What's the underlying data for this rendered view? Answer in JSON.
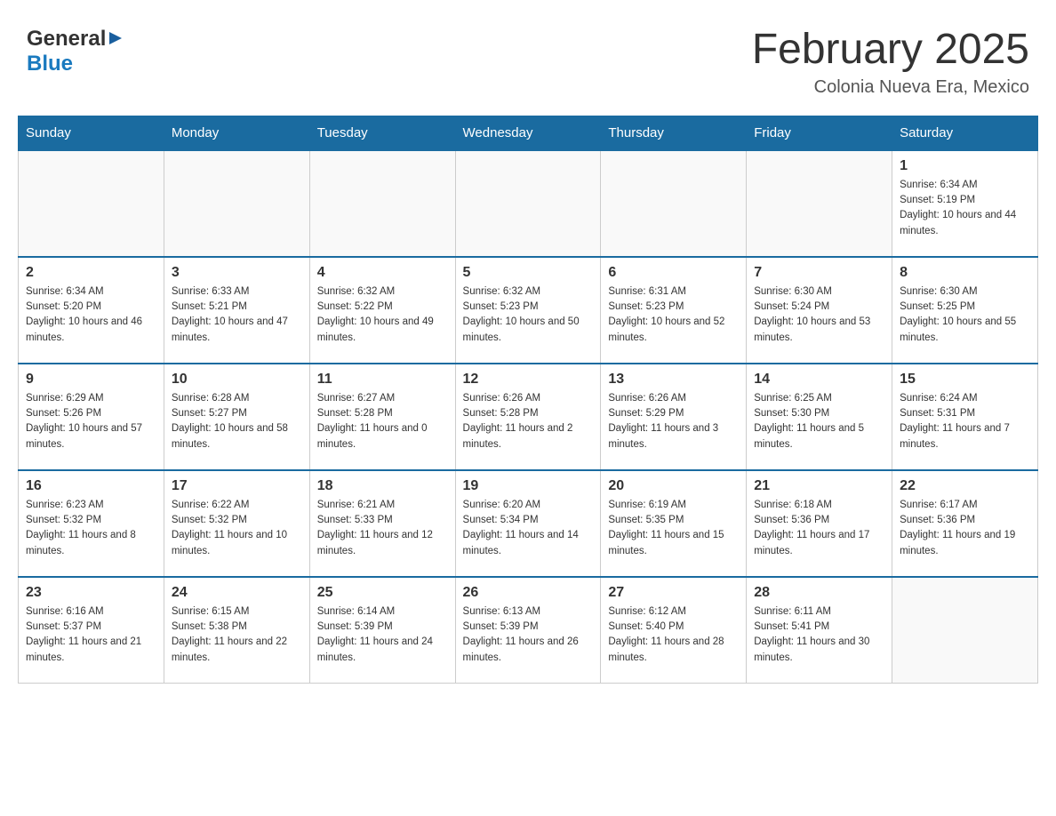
{
  "header": {
    "logo_general": "General",
    "logo_blue": "Blue",
    "month_title": "February 2025",
    "location": "Colonia Nueva Era, Mexico"
  },
  "days_of_week": [
    "Sunday",
    "Monday",
    "Tuesday",
    "Wednesday",
    "Thursday",
    "Friday",
    "Saturday"
  ],
  "weeks": [
    {
      "days": [
        {
          "num": "",
          "info": ""
        },
        {
          "num": "",
          "info": ""
        },
        {
          "num": "",
          "info": ""
        },
        {
          "num": "",
          "info": ""
        },
        {
          "num": "",
          "info": ""
        },
        {
          "num": "",
          "info": ""
        },
        {
          "num": "1",
          "info": "Sunrise: 6:34 AM\nSunset: 5:19 PM\nDaylight: 10 hours and 44 minutes."
        }
      ]
    },
    {
      "days": [
        {
          "num": "2",
          "info": "Sunrise: 6:34 AM\nSunset: 5:20 PM\nDaylight: 10 hours and 46 minutes."
        },
        {
          "num": "3",
          "info": "Sunrise: 6:33 AM\nSunset: 5:21 PM\nDaylight: 10 hours and 47 minutes."
        },
        {
          "num": "4",
          "info": "Sunrise: 6:32 AM\nSunset: 5:22 PM\nDaylight: 10 hours and 49 minutes."
        },
        {
          "num": "5",
          "info": "Sunrise: 6:32 AM\nSunset: 5:23 PM\nDaylight: 10 hours and 50 minutes."
        },
        {
          "num": "6",
          "info": "Sunrise: 6:31 AM\nSunset: 5:23 PM\nDaylight: 10 hours and 52 minutes."
        },
        {
          "num": "7",
          "info": "Sunrise: 6:30 AM\nSunset: 5:24 PM\nDaylight: 10 hours and 53 minutes."
        },
        {
          "num": "8",
          "info": "Sunrise: 6:30 AM\nSunset: 5:25 PM\nDaylight: 10 hours and 55 minutes."
        }
      ]
    },
    {
      "days": [
        {
          "num": "9",
          "info": "Sunrise: 6:29 AM\nSunset: 5:26 PM\nDaylight: 10 hours and 57 minutes."
        },
        {
          "num": "10",
          "info": "Sunrise: 6:28 AM\nSunset: 5:27 PM\nDaylight: 10 hours and 58 minutes."
        },
        {
          "num": "11",
          "info": "Sunrise: 6:27 AM\nSunset: 5:28 PM\nDaylight: 11 hours and 0 minutes."
        },
        {
          "num": "12",
          "info": "Sunrise: 6:26 AM\nSunset: 5:28 PM\nDaylight: 11 hours and 2 minutes."
        },
        {
          "num": "13",
          "info": "Sunrise: 6:26 AM\nSunset: 5:29 PM\nDaylight: 11 hours and 3 minutes."
        },
        {
          "num": "14",
          "info": "Sunrise: 6:25 AM\nSunset: 5:30 PM\nDaylight: 11 hours and 5 minutes."
        },
        {
          "num": "15",
          "info": "Sunrise: 6:24 AM\nSunset: 5:31 PM\nDaylight: 11 hours and 7 minutes."
        }
      ]
    },
    {
      "days": [
        {
          "num": "16",
          "info": "Sunrise: 6:23 AM\nSunset: 5:32 PM\nDaylight: 11 hours and 8 minutes."
        },
        {
          "num": "17",
          "info": "Sunrise: 6:22 AM\nSunset: 5:32 PM\nDaylight: 11 hours and 10 minutes."
        },
        {
          "num": "18",
          "info": "Sunrise: 6:21 AM\nSunset: 5:33 PM\nDaylight: 11 hours and 12 minutes."
        },
        {
          "num": "19",
          "info": "Sunrise: 6:20 AM\nSunset: 5:34 PM\nDaylight: 11 hours and 14 minutes."
        },
        {
          "num": "20",
          "info": "Sunrise: 6:19 AM\nSunset: 5:35 PM\nDaylight: 11 hours and 15 minutes."
        },
        {
          "num": "21",
          "info": "Sunrise: 6:18 AM\nSunset: 5:36 PM\nDaylight: 11 hours and 17 minutes."
        },
        {
          "num": "22",
          "info": "Sunrise: 6:17 AM\nSunset: 5:36 PM\nDaylight: 11 hours and 19 minutes."
        }
      ]
    },
    {
      "days": [
        {
          "num": "23",
          "info": "Sunrise: 6:16 AM\nSunset: 5:37 PM\nDaylight: 11 hours and 21 minutes."
        },
        {
          "num": "24",
          "info": "Sunrise: 6:15 AM\nSunset: 5:38 PM\nDaylight: 11 hours and 22 minutes."
        },
        {
          "num": "25",
          "info": "Sunrise: 6:14 AM\nSunset: 5:39 PM\nDaylight: 11 hours and 24 minutes."
        },
        {
          "num": "26",
          "info": "Sunrise: 6:13 AM\nSunset: 5:39 PM\nDaylight: 11 hours and 26 minutes."
        },
        {
          "num": "27",
          "info": "Sunrise: 6:12 AM\nSunset: 5:40 PM\nDaylight: 11 hours and 28 minutes."
        },
        {
          "num": "28",
          "info": "Sunrise: 6:11 AM\nSunset: 5:41 PM\nDaylight: 11 hours and 30 minutes."
        },
        {
          "num": "",
          "info": ""
        }
      ]
    }
  ]
}
